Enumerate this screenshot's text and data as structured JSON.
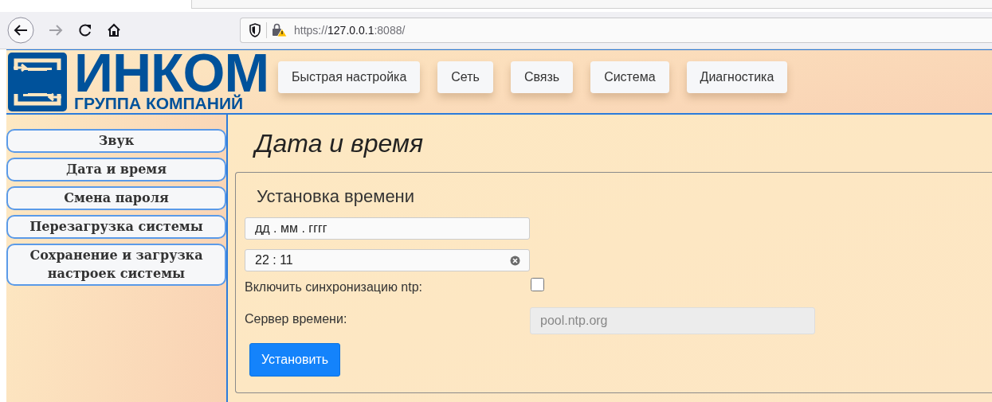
{
  "browser": {
    "url": "https://**127.0.0.1**:8088/"
  },
  "logo": {
    "name": "ИНКОМ",
    "tagline": "ГРУППА КОМПАНИЙ"
  },
  "nav": [
    "Быстрая настройка",
    "Сеть",
    "Связь",
    "Система",
    "Диагностика"
  ],
  "sidebar": {
    "items": [
      "Звук",
      "Дата и время",
      "Смена пароля",
      "Перезагрузка системы",
      "Сохранение и загрузка настроек системы"
    ]
  },
  "page_title": "Дата и время",
  "panel": {
    "title": "Установка времени",
    "date_field": {
      "placeholder": "дд . мм . гггг"
    },
    "time_field": {
      "value": "22 : 11"
    },
    "ntp_sync": {
      "label": "Включить синхронизацию ntp:",
      "checked": false
    },
    "server": {
      "label": "Сервер времени:",
      "value": "pool.ntp.org",
      "disabled": true
    },
    "submit": "Установить"
  }
}
